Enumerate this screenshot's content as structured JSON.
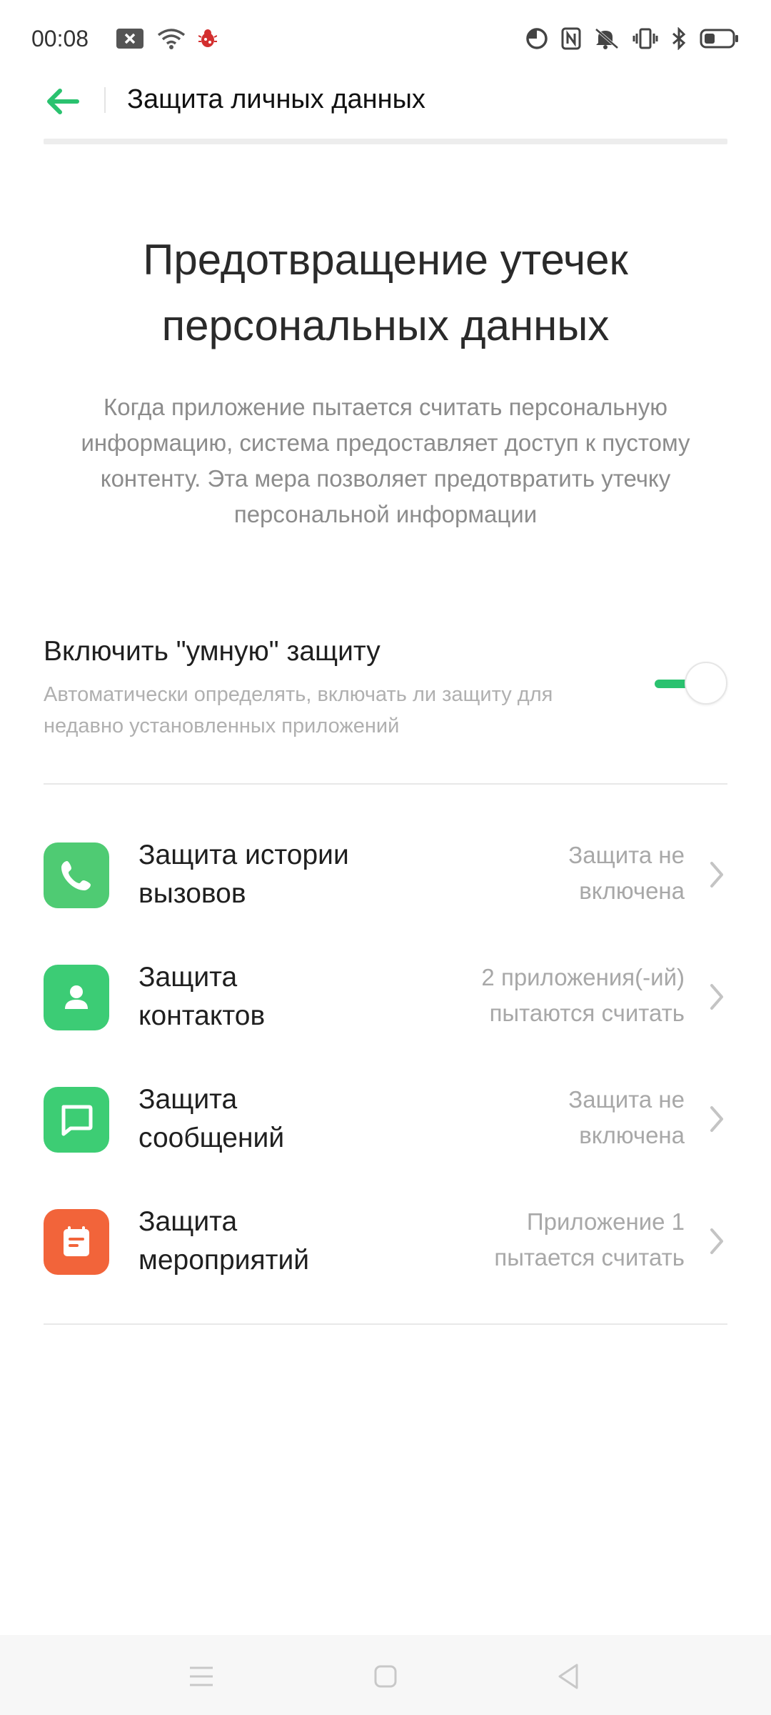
{
  "status_bar": {
    "time": "00:08",
    "icons": [
      "close-notification-icon",
      "wifi-icon",
      "bug-icon",
      "dnd-icon",
      "nfc-icon",
      "mute-icon",
      "vibrate-icon",
      "bluetooth-icon",
      "battery-icon"
    ]
  },
  "header": {
    "title": "Защита личных данных"
  },
  "hero": {
    "title": "Предотвращение утечек\nперсональных данных",
    "description": "Когда приложение пытается считать персональную информацию, система предоставляет доступ к пустому контенту. Эта мера позволяет предотвратить утечку персональной информации"
  },
  "smart_protection": {
    "title": "Включить \"умную\" защиту",
    "subtitle": "Автоматически определять, включать ли защиту для недавно установленных приложений",
    "enabled": true
  },
  "items": [
    {
      "title": "Защита истории\nвызовов",
      "status": "Защита не\nвключена",
      "icon": "phone-icon",
      "color": "#4fcb73"
    },
    {
      "title": "Защита\nконтактов",
      "status": "2 приложения(-ий)\nпытаются считать",
      "icon": "contact-icon",
      "color": "#3ccc75"
    },
    {
      "title": "Защита\nсообщений",
      "status": "Защита не\nвключена",
      "icon": "message-icon",
      "color": "#3dcd74"
    },
    {
      "title": "Защита\nмероприятий",
      "status": "Приложение 1\nпытается считать",
      "icon": "calendar-icon",
      "color": "#f2643a"
    }
  ],
  "colors": {
    "accent": "#2ac26f",
    "background": "#ffffff"
  },
  "nav": {
    "icons": [
      "menu-icon",
      "home-icon",
      "back-icon"
    ]
  }
}
